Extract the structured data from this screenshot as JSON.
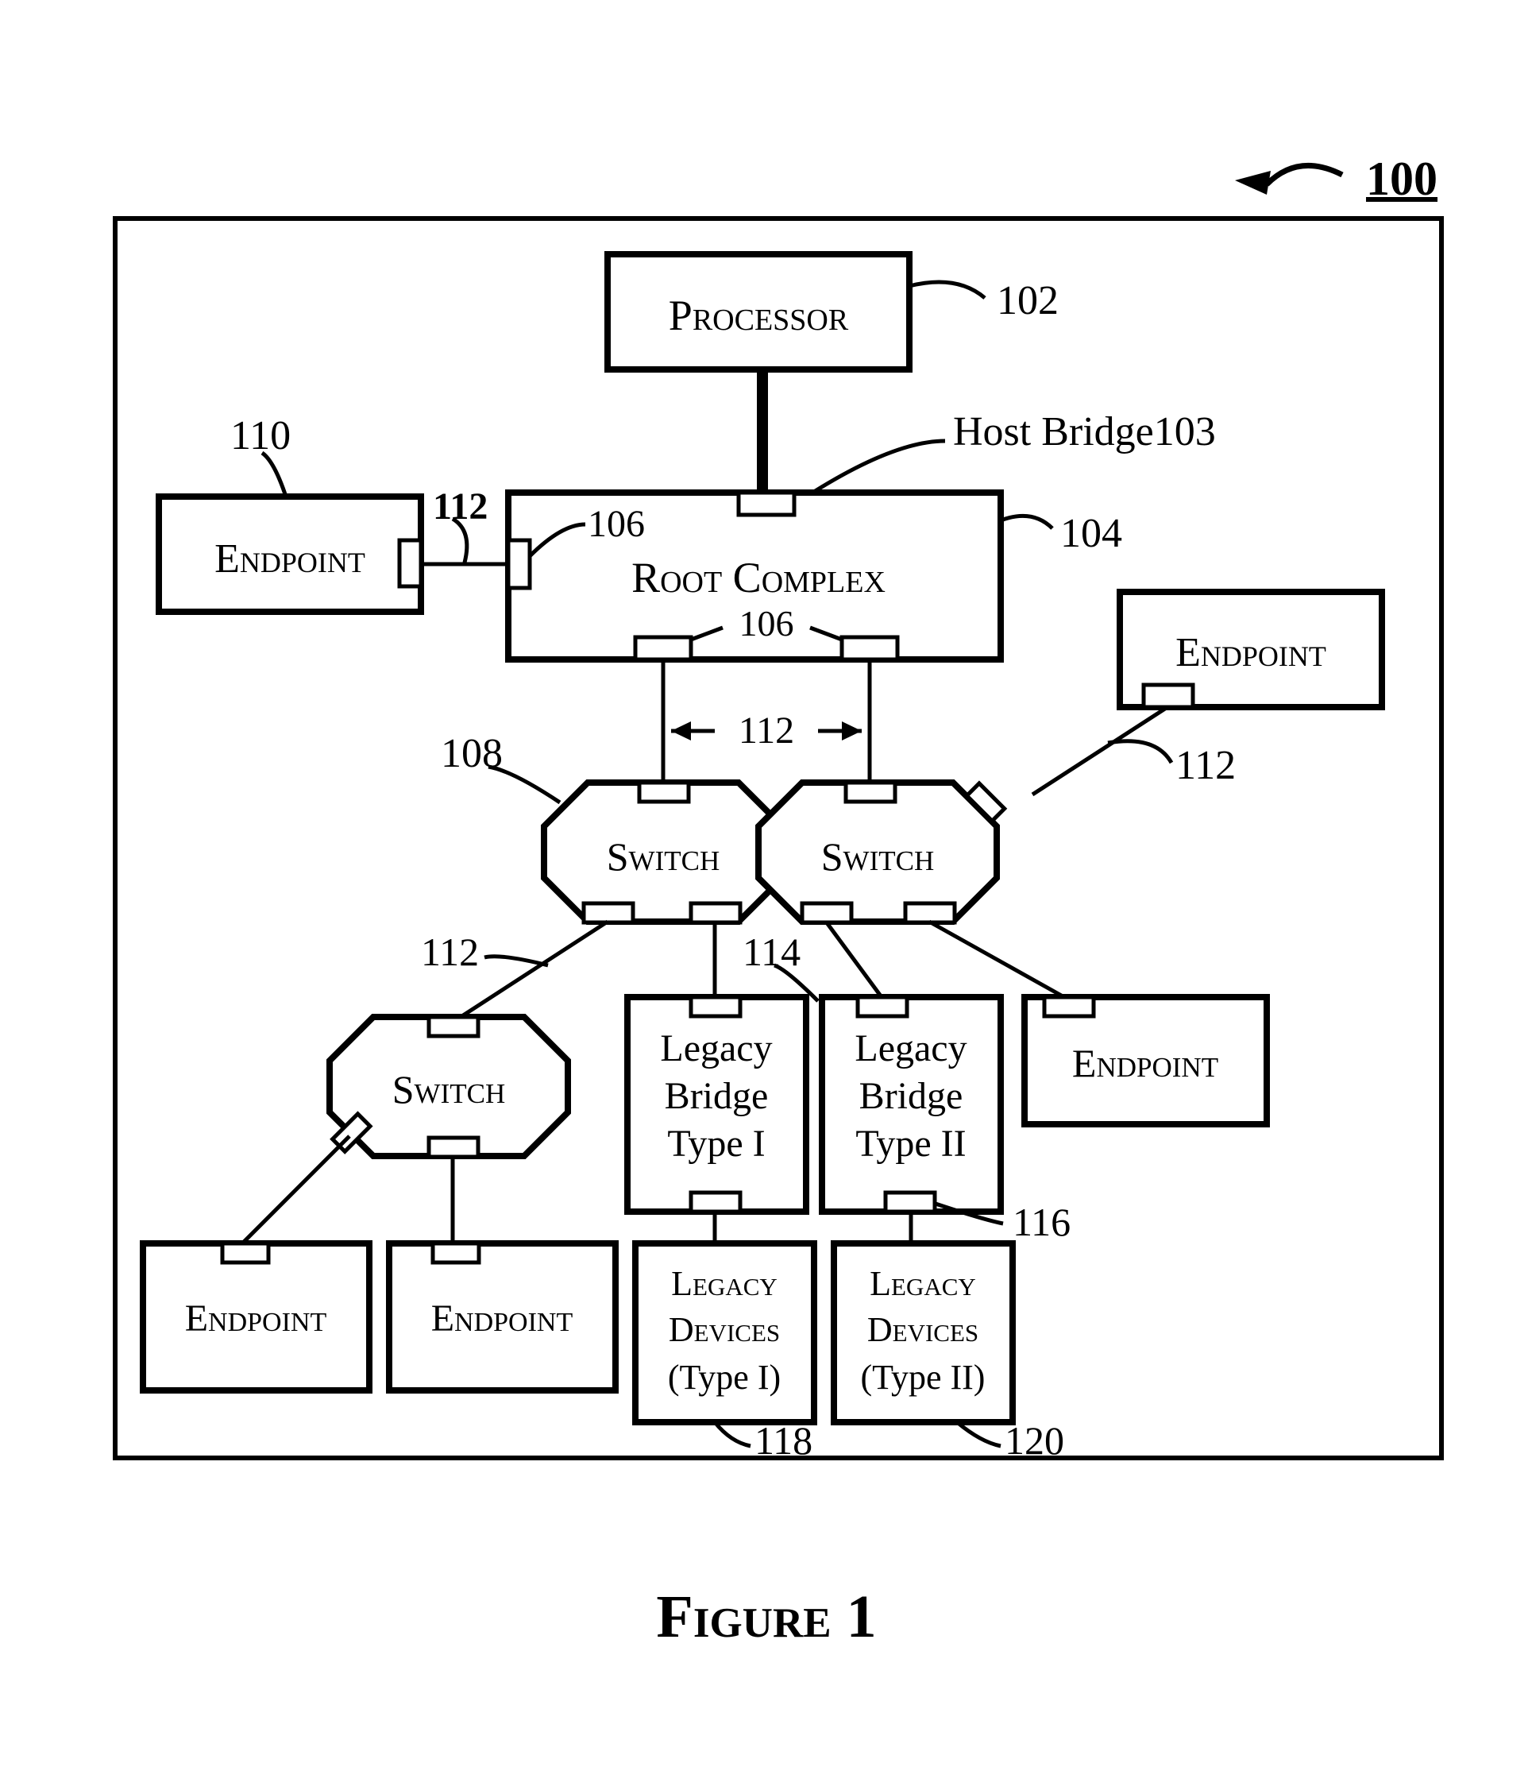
{
  "figure": {
    "label_100": "100",
    "caption": "Figure 1"
  },
  "boxes": {
    "processor": "Processor",
    "root_complex": "Root Complex",
    "switch": "Switch",
    "endpoint": "Endpoint",
    "legacy_bridge_type1_line1": "Legacy",
    "legacy_bridge_type1_line2": "Bridge",
    "legacy_bridge_type1_line3": "Type I",
    "legacy_bridge_type2_line1": "Legacy",
    "legacy_bridge_type2_line2": "Bridge",
    "legacy_bridge_type2_line3": "Type II",
    "legacy_devices_type1_line1": "Legacy",
    "legacy_devices_type1_line2": "Devices",
    "legacy_devices_type1_line3": "(Type I)",
    "legacy_devices_type2_line1": "Legacy",
    "legacy_devices_type2_line2": "Devices",
    "legacy_devices_type2_line3": "(Type II)"
  },
  "labels": {
    "n102": "102",
    "host_bridge103": "Host Bridge103",
    "n104": "104",
    "n106_left": "106",
    "n106_mid": "106",
    "n108": "108",
    "n110": "110",
    "n112_lefttop": "112",
    "n112_midtop": "112",
    "n112_rightmid": "112",
    "n112_leftmid": "112",
    "n114": "114",
    "n116": "116",
    "n118": "118",
    "n120": "120"
  }
}
